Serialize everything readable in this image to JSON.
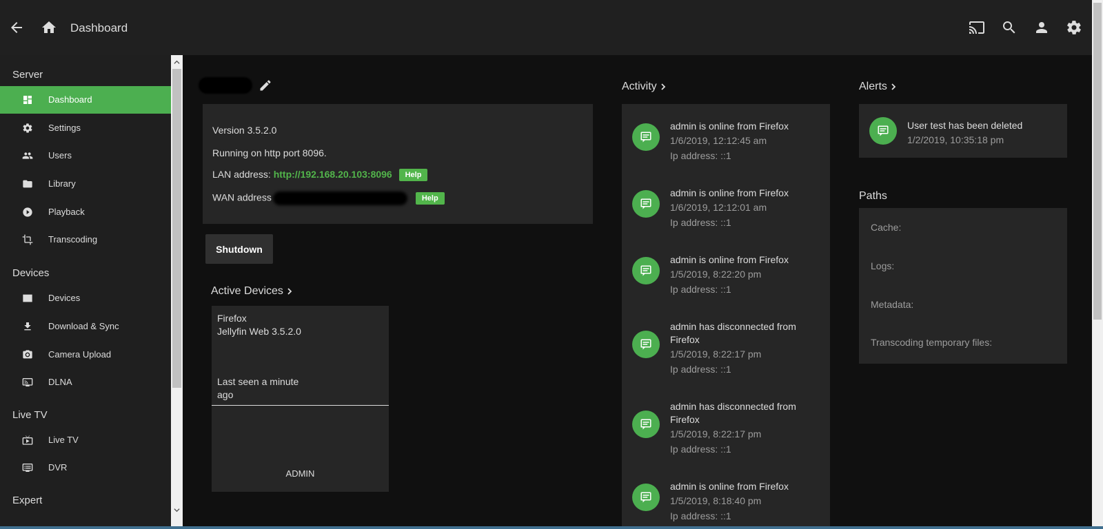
{
  "header": {
    "title": "Dashboard",
    "icons": [
      "back-arrow-icon",
      "home-icon",
      "cast-icon",
      "search-icon",
      "user-icon",
      "settings-icon"
    ]
  },
  "sidebar": {
    "sections": [
      {
        "label": "Server",
        "items": [
          {
            "label": "Dashboard",
            "icon": "dashboard-icon",
            "active": true
          },
          {
            "label": "Settings",
            "icon": "gear-icon"
          },
          {
            "label": "Users",
            "icon": "people-icon"
          },
          {
            "label": "Library",
            "icon": "folder-icon"
          },
          {
            "label": "Playback",
            "icon": "play-circle-icon"
          },
          {
            "label": "Transcoding",
            "icon": "crop-icon"
          }
        ]
      },
      {
        "label": "Devices",
        "items": [
          {
            "label": "Devices",
            "icon": "monitor-icon"
          },
          {
            "label": "Download & Sync",
            "icon": "download-icon"
          },
          {
            "label": "Camera Upload",
            "icon": "camera-icon"
          },
          {
            "label": "DLNA",
            "icon": "connected-tv-icon"
          }
        ]
      },
      {
        "label": "Live TV",
        "items": [
          {
            "label": "Live TV",
            "icon": "live-tv-icon"
          },
          {
            "label": "DVR",
            "icon": "dvr-icon"
          }
        ]
      },
      {
        "label": "Expert",
        "items": []
      }
    ]
  },
  "server": {
    "version": "Version 3.5.2.0",
    "port": "Running on http port 8096.",
    "lan_label": "LAN address:",
    "lan_value": "http://192.168.20.103:8096",
    "wan_label": "WAN address",
    "help_label": "Help",
    "shutdown_label": "Shutdown"
  },
  "active_devices": {
    "title": "Active Devices",
    "device": {
      "client": "Firefox",
      "app": "Jellyfin Web 3.5.2.0",
      "last_seen_1": "Last seen a minute",
      "last_seen_2": "ago",
      "user": "ADMIN"
    }
  },
  "activity": {
    "title": "Activity",
    "items": [
      {
        "title": [
          "admin is online from Firefox"
        ],
        "time": "1/6/2019, 12:12:45 am",
        "ip": "Ip address: ::1"
      },
      {
        "title": [
          "admin is online from Firefox"
        ],
        "time": "1/6/2019, 12:12:01 am",
        "ip": "Ip address: ::1"
      },
      {
        "title": [
          "admin is online from Firefox"
        ],
        "time": "1/5/2019, 8:22:20 pm",
        "ip": "Ip address: ::1"
      },
      {
        "title": [
          "admin has disconnected from",
          "Firefox"
        ],
        "time": "1/5/2019, 8:22:17 pm",
        "ip": "Ip address: ::1"
      },
      {
        "title": [
          "admin has disconnected from",
          "Firefox"
        ],
        "time": "1/5/2019, 8:22:17 pm",
        "ip": "Ip address: ::1"
      },
      {
        "title": [
          "admin is online from Firefox"
        ],
        "time": "1/5/2019, 8:18:40 pm",
        "ip": "Ip address: ::1"
      }
    ]
  },
  "alerts": {
    "title": "Alerts",
    "items": [
      {
        "title": "User test has been deleted",
        "time": "1/2/2019, 10:35:18 pm"
      }
    ]
  },
  "paths": {
    "title": "Paths",
    "items": [
      "Cache:",
      "Logs:",
      "Metadata:",
      "Transcoding temporary files:"
    ]
  },
  "colors": {
    "accent": "#4caf50",
    "link": "#52b54b",
    "card": "#262626",
    "background": "#101010",
    "header": "#202020"
  }
}
